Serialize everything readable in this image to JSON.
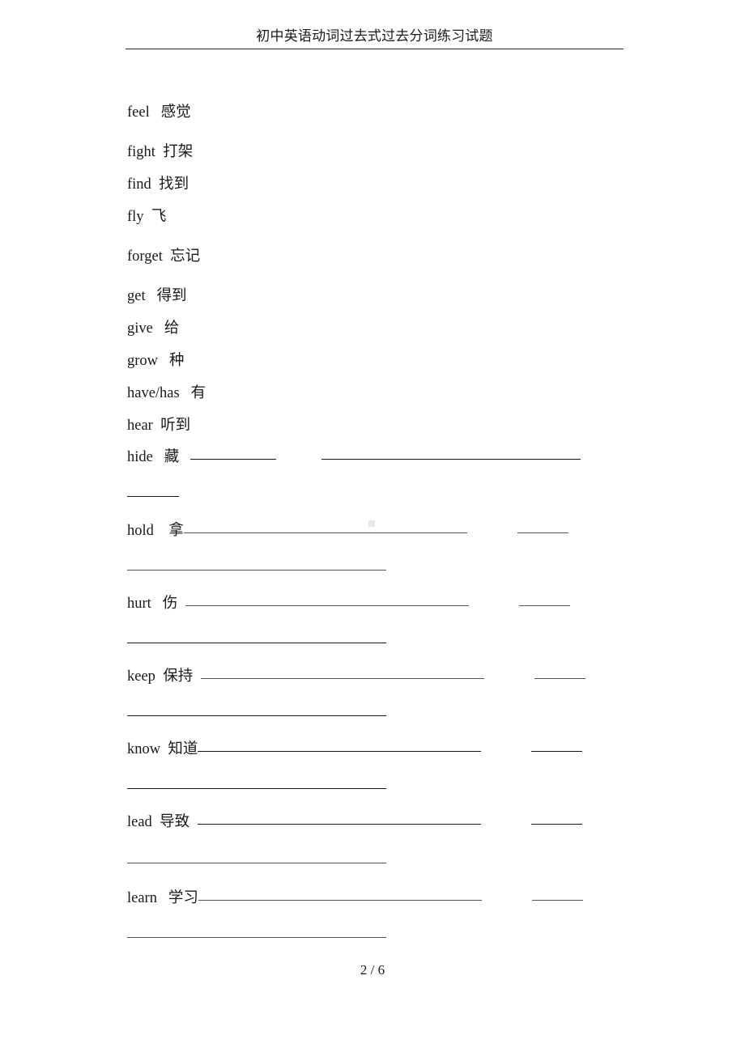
{
  "header": {
    "title": "初中英语动词过去式过去分词练习试题"
  },
  "footer": {
    "page_number": "2 / 6"
  },
  "entries": [
    {
      "term": "feel",
      "gloss": "感觉"
    },
    {
      "term": "fight",
      "gloss": "打架"
    },
    {
      "term": "find",
      "gloss": "找到"
    },
    {
      "term": "fly",
      "gloss": "飞"
    },
    {
      "term": "forget",
      "gloss": "忘记"
    },
    {
      "term": "get",
      "gloss": "得到"
    },
    {
      "term": "give",
      "gloss": "给"
    },
    {
      "term": "grow",
      "gloss": "种"
    },
    {
      "term": "have/has",
      "gloss": "有"
    },
    {
      "term": "hear",
      "gloss": "听到"
    }
  ],
  "blank_entries": [
    {
      "term": "hide",
      "gloss": "藏"
    },
    {
      "term": "hold",
      "gloss": "拿"
    },
    {
      "term": "hurt",
      "gloss": "伤"
    },
    {
      "term": "keep",
      "gloss": "保持"
    },
    {
      "term": "know",
      "gloss": "知道"
    },
    {
      "term": "lead",
      "gloss": "导致"
    },
    {
      "term": "learn",
      "gloss": "学习"
    }
  ]
}
